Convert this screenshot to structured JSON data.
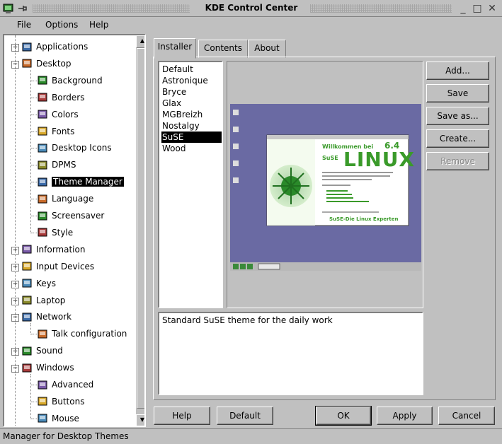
{
  "window": {
    "title": "KDE Control Center",
    "minimize_glyph": "_",
    "maximize_glyph": "□",
    "close_glyph": "✕"
  },
  "menu": [
    {
      "label": "File"
    },
    {
      "label": "Options"
    },
    {
      "label": "Help"
    }
  ],
  "tree": [
    {
      "label": "Applications",
      "icon": "applications-icon",
      "expander": "+"
    },
    {
      "label": "Desktop",
      "icon": "desktop-icon",
      "expander": "−"
    },
    {
      "label": "Background",
      "icon": "background-icon"
    },
    {
      "label": "Borders",
      "icon": "borders-icon"
    },
    {
      "label": "Colors",
      "icon": "colors-icon"
    },
    {
      "label": "Fonts",
      "icon": "fonts-icon"
    },
    {
      "label": "Desktop Icons",
      "icon": "desktop-icons-icon"
    },
    {
      "label": "DPMS",
      "icon": "dpms-icon"
    },
    {
      "label": "Theme Manager",
      "icon": "theme-manager-icon",
      "selected": true
    },
    {
      "label": "Language",
      "icon": "language-icon"
    },
    {
      "label": "Screensaver",
      "icon": "screensaver-icon"
    },
    {
      "label": "Style",
      "icon": "style-icon"
    },
    {
      "label": "Information",
      "icon": "information-icon",
      "expander": "+"
    },
    {
      "label": "Input Devices",
      "icon": "input-devices-icon",
      "expander": "+"
    },
    {
      "label": "Keys",
      "icon": "keys-icon",
      "expander": "+"
    },
    {
      "label": "Laptop",
      "icon": "laptop-icon",
      "expander": "+"
    },
    {
      "label": "Network",
      "icon": "network-icon",
      "expander": "−"
    },
    {
      "label": "Talk configuration",
      "icon": "talk-icon"
    },
    {
      "label": "Sound",
      "icon": "sound-icon",
      "expander": "+"
    },
    {
      "label": "Windows",
      "icon": "windows-icon",
      "expander": "−"
    },
    {
      "label": "Advanced",
      "icon": "advanced-icon"
    },
    {
      "label": "Buttons",
      "icon": "buttons-icon"
    },
    {
      "label": "Mouse",
      "icon": "mouse-icon"
    }
  ],
  "tabs": [
    {
      "label": "Installer",
      "active": true
    },
    {
      "label": "Contents"
    },
    {
      "label": "About"
    }
  ],
  "themes": [
    "Default",
    "Astronique",
    "Bryce",
    "Glax",
    "MGBreizh",
    "Nostalgy",
    "SuSE",
    "Wood"
  ],
  "selected_theme": "SuSE",
  "preview": {
    "banner_title": "Willkommen bei",
    "version": "6.4",
    "brand_small": "SuSE",
    "brand_big": "LINUX",
    "footer": "SuSE-Die Linux Experten"
  },
  "description": "Standard SuSE theme for the daily work",
  "side_buttons": [
    {
      "label": "Add...",
      "enabled": true
    },
    {
      "label": "Save",
      "enabled": true
    },
    {
      "label": "Save as...",
      "enabled": true
    },
    {
      "label": "Create...",
      "enabled": true
    },
    {
      "label": "Remove",
      "enabled": false
    }
  ],
  "bottom_buttons": {
    "help": "Help",
    "default": "Default",
    "ok": "OK",
    "apply": "Apply",
    "cancel": "Cancel"
  },
  "status": "Manager for Desktop Themes",
  "colors": {
    "face": "#c0c0c0",
    "selection": "#000000",
    "preview_desktop": "#6a6aa3",
    "suse_green": "#3a9a2a"
  }
}
